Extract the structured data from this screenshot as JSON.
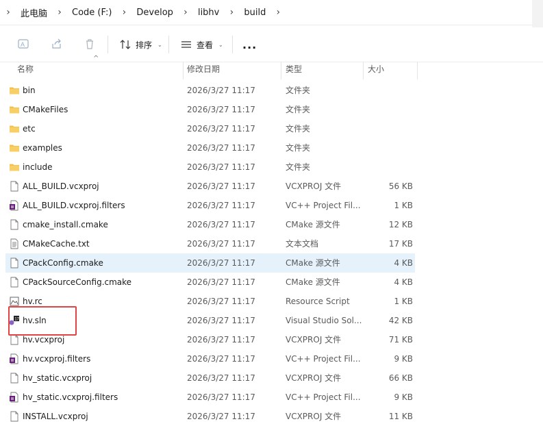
{
  "breadcrumb": {
    "items": [
      "此电脑",
      "Code (F:)",
      "Develop",
      "libhv",
      "build"
    ]
  },
  "toolbar": {
    "sort_label": "排序",
    "view_label": "查看",
    "more_label": "..."
  },
  "columns": {
    "name": "名称",
    "date": "修改日期",
    "type": "类型",
    "size": "大小"
  },
  "files": [
    {
      "name": "bin",
      "date": "2026/3/27 11:17",
      "type": "文件夹",
      "size": "",
      "icon": "folder-icon"
    },
    {
      "name": "CMakeFiles",
      "date": "2026/3/27 11:17",
      "type": "文件夹",
      "size": "",
      "icon": "folder-icon"
    },
    {
      "name": "etc",
      "date": "2026/3/27 11:17",
      "type": "文件夹",
      "size": "",
      "icon": "folder-icon"
    },
    {
      "name": "examples",
      "date": "2026/3/27 11:17",
      "type": "文件夹",
      "size": "",
      "icon": "folder-icon"
    },
    {
      "name": "include",
      "date": "2026/3/27 11:17",
      "type": "文件夹",
      "size": "",
      "icon": "folder-icon"
    },
    {
      "name": "ALL_BUILD.vcxproj",
      "date": "2026/3/27 11:17",
      "type": "VCXPROJ 文件",
      "size": "56 KB",
      "icon": "document-icon"
    },
    {
      "name": "ALL_BUILD.vcxproj.filters",
      "date": "2026/3/27 11:17",
      "type": "VC++ Project Fil...",
      "size": "1 KB",
      "icon": "vc-filters-icon"
    },
    {
      "name": "cmake_install.cmake",
      "date": "2026/3/27 11:17",
      "type": "CMake 源文件",
      "size": "12 KB",
      "icon": "document-icon"
    },
    {
      "name": "CMakeCache.txt",
      "date": "2026/3/27 11:17",
      "type": "文本文档",
      "size": "17 KB",
      "icon": "text-document-icon"
    },
    {
      "name": "CPackConfig.cmake",
      "date": "2026/3/27 11:17",
      "type": "CMake 源文件",
      "size": "4 KB",
      "icon": "document-icon"
    },
    {
      "name": "CPackSourceConfig.cmake",
      "date": "2026/3/27 11:17",
      "type": "CMake 源文件",
      "size": "4 KB",
      "icon": "document-icon"
    },
    {
      "name": "hv.rc",
      "date": "2026/3/27 11:17",
      "type": "Resource Script",
      "size": "1 KB",
      "icon": "resource-script-icon"
    },
    {
      "name": "hv.sln",
      "date": "2026/3/27 11:17",
      "type": "Visual Studio Sol...",
      "size": "42 KB",
      "icon": "visual-studio-solution-icon"
    },
    {
      "name": "hv.vcxproj",
      "date": "2026/3/27 11:17",
      "type": "VCXPROJ 文件",
      "size": "71 KB",
      "icon": "document-icon"
    },
    {
      "name": "hv.vcxproj.filters",
      "date": "2026/3/27 11:17",
      "type": "VC++ Project Fil...",
      "size": "9 KB",
      "icon": "vc-filters-icon"
    },
    {
      "name": "hv_static.vcxproj",
      "date": "2026/3/27 11:17",
      "type": "VCXPROJ 文件",
      "size": "66 KB",
      "icon": "document-icon"
    },
    {
      "name": "hv_static.vcxproj.filters",
      "date": "2026/3/27 11:17",
      "type": "VC++ Project Fil...",
      "size": "9 KB",
      "icon": "vc-filters-icon"
    },
    {
      "name": "INSTALL.vcxproj",
      "date": "2026/3/27 11:17",
      "type": "VCXPROJ 文件",
      "size": "11 KB",
      "icon": "document-icon"
    }
  ],
  "selected_file": "CPackConfig.cmake",
  "highlighted_file": "hv.sln",
  "colors": {
    "folder": "#f4c14e",
    "selection": "#e5f1fb",
    "highlight_border": "#e04343"
  }
}
